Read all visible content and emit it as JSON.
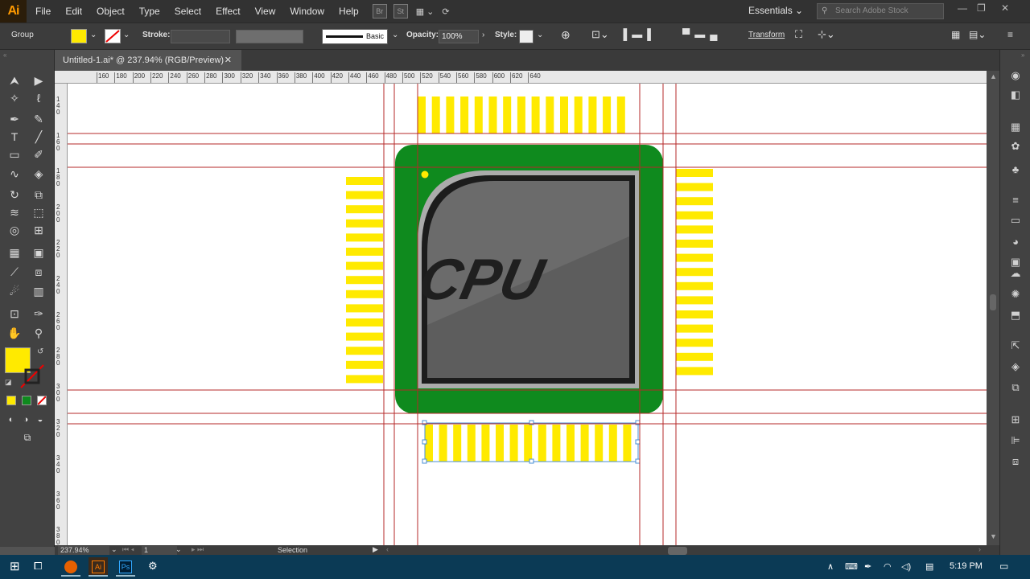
{
  "app": {
    "logo": "Ai"
  },
  "menu": [
    "File",
    "Edit",
    "Object",
    "Type",
    "Select",
    "Effect",
    "View",
    "Window",
    "Help"
  ],
  "appicons": [
    "Br",
    "St"
  ],
  "workspace": "Essentials",
  "search_placeholder": "Search Adobe Stock",
  "control": {
    "group_label": "Group",
    "stroke_label": "Stroke:",
    "brush_label": "Basic",
    "opacity_label": "Opacity:",
    "opacity_value": "100%",
    "style_label": "Style:",
    "transform_label": "Transform",
    "fill_color": "#ffea00"
  },
  "document_tab": "Untitled-1.ai* @ 237.94% (RGB/Preview)",
  "ruler_h": [
    "160",
    "180",
    "200",
    "220",
    "240",
    "260",
    "280",
    "300",
    "320",
    "340",
    "360",
    "380",
    "400",
    "420",
    "440",
    "460",
    "480",
    "500",
    "520",
    "540",
    "560",
    "580",
    "600",
    "620",
    "640"
  ],
  "ruler_v": [
    "140",
    "160",
    "180",
    "200",
    "220",
    "240",
    "260",
    "280",
    "300",
    "320",
    "340",
    "360",
    "380"
  ],
  "artwork": {
    "label": "CPU",
    "green": "#0f8a1e",
    "pin_color": "#ffea00",
    "die_color": "#6b6b6b"
  },
  "status": {
    "zoom": "237.94%",
    "page": "1",
    "tool": "Selection"
  },
  "taskbar": {
    "time": "5:19 PM",
    "apps": [
      "Ai",
      "Ps"
    ]
  }
}
